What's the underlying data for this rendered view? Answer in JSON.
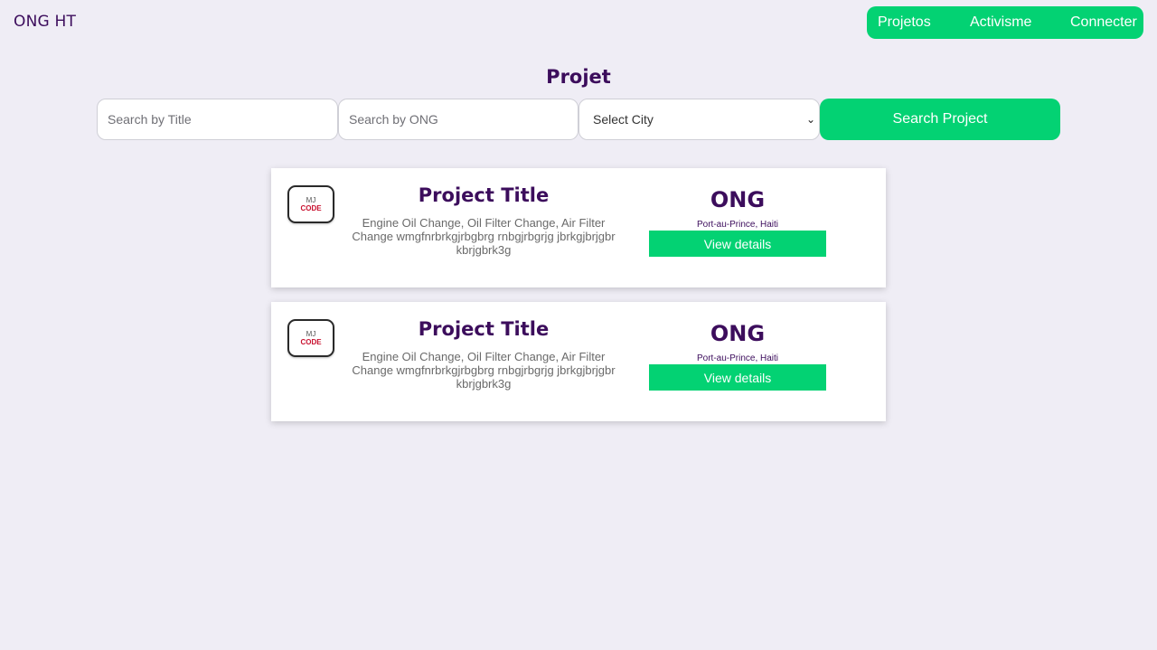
{
  "brand": "ONG HT",
  "nav": {
    "items": [
      {
        "label": "Projetos"
      },
      {
        "label": "Activisme"
      },
      {
        "label": "Connecter"
      }
    ]
  },
  "page_title": "Projet",
  "search": {
    "title_placeholder": "Search by Title",
    "ong_placeholder": "Search by ONG",
    "city_selected": "Select City",
    "button_label": "Search Project"
  },
  "projects": [
    {
      "logo_line1": "MJ",
      "logo_line2": "CODE",
      "title": "Project Title",
      "description": "Engine Oil Change, Oil Filter Change, Air Filter Change wmgfnrbrkgjrbgbrg rnbgjrbgrjg jbrkgjbrjgbr kbrjgbrk3g",
      "ong": "ONG",
      "city": "Port-au-Prince, Haiti",
      "button_label": "View details"
    },
    {
      "logo_line1": "MJ",
      "logo_line2": "CODE",
      "title": "Project Title",
      "description": "Engine Oil Change, Oil Filter Change, Air Filter Change wmgfnrbrkgjrbgbrg rnbgjrbgrjg jbrkgjbrjgbr kbrjgbrk3g",
      "ong": "ONG",
      "city": "Port-au-Prince, Haiti",
      "button_label": "View details"
    }
  ],
  "colors": {
    "accent": "#03d273",
    "brand_purple": "#3c0d5c",
    "background": "#efedf5"
  }
}
